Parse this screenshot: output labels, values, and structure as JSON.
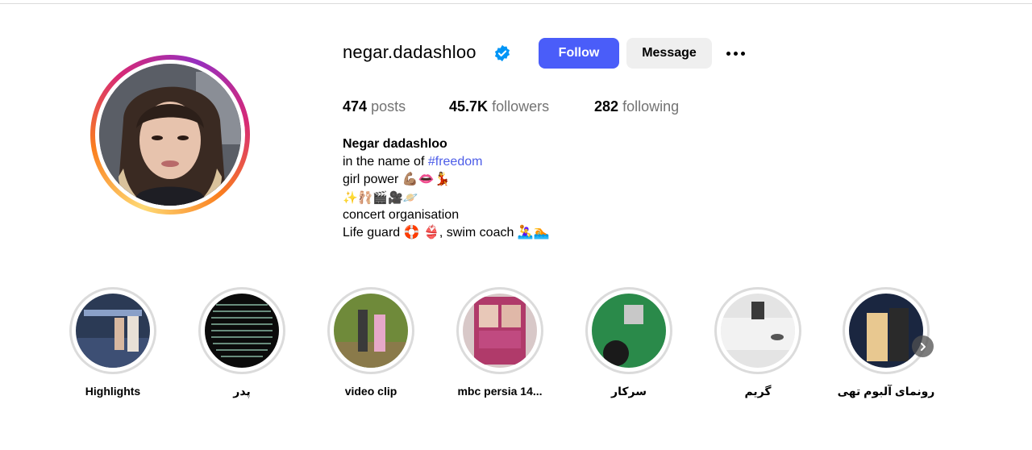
{
  "profile": {
    "username": "negar.dadashloo",
    "follow_label": "Follow",
    "message_label": "Message",
    "stats": {
      "posts_count": "474",
      "posts_label": "posts",
      "followers_count": "45.7K",
      "followers_label": "followers",
      "following_count": "282",
      "following_label": "following"
    },
    "bio": {
      "name": "Negar dadashloo",
      "line1_text": "in the name of ",
      "line1_hashtag": "#freedom",
      "line2": "girl power 💪🏽👄💃",
      "line3": "✨🩰🎬🎥🪐",
      "line4": "concert organisation",
      "line5": "Life guard 🛟 👙, swim coach 🤽‍♀️🏊"
    }
  },
  "highlights": [
    {
      "label": "Highlights"
    },
    {
      "label": "پدر"
    },
    {
      "label": "video clip"
    },
    {
      "label": "mbc persia 14..."
    },
    {
      "label": "سرکار"
    },
    {
      "label": "گریم"
    },
    {
      "label": "رونمای آلبوم تهی"
    }
  ],
  "colors": {
    "follow_button": "#4a5df9",
    "message_button": "#efefef",
    "hashtag": "#4c5ce8",
    "verified_badge": "#0095f6",
    "muted_text": "#737373"
  },
  "icons": {
    "verified": "verified-badge-icon",
    "more": "more-options-icon",
    "next": "chevron-right-icon"
  }
}
